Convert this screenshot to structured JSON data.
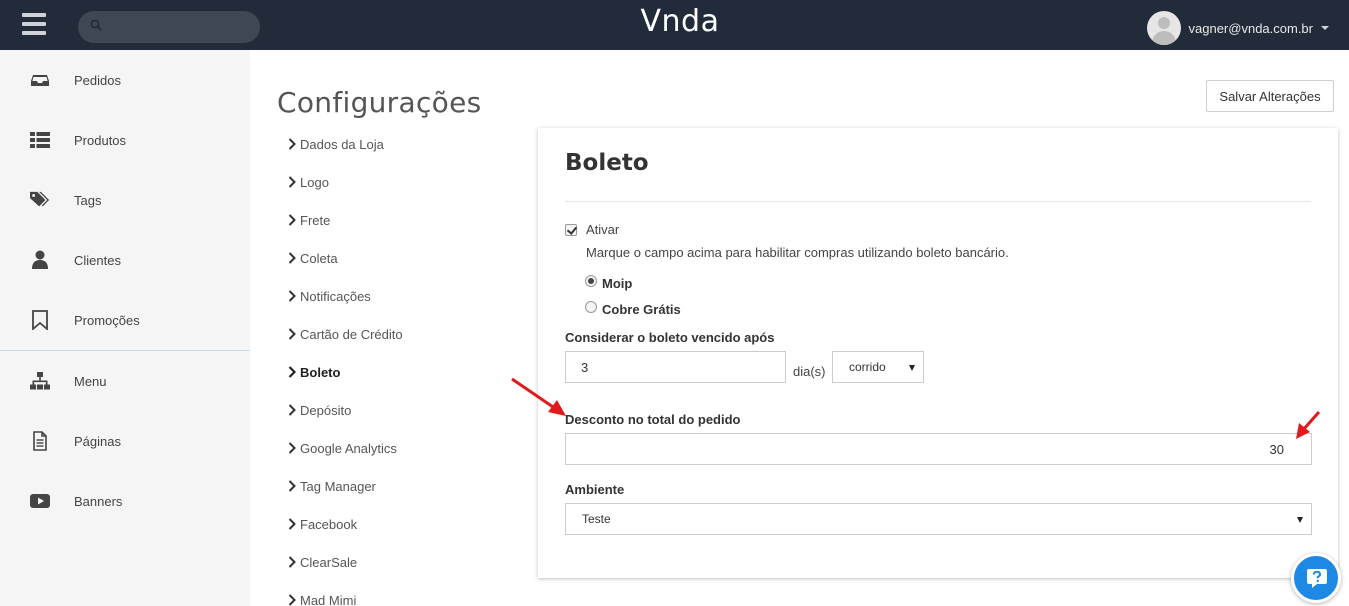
{
  "app": {
    "brand": "Vnda",
    "search_placeholder": "",
    "user_email": "vagner@vnda.com.br"
  },
  "sidebar": {
    "items": [
      {
        "label": "Pedidos",
        "icon": "inbox-icon"
      },
      {
        "label": "Produtos",
        "icon": "list-icon"
      },
      {
        "label": "Tags",
        "icon": "tags-icon"
      },
      {
        "label": "Clientes",
        "icon": "user-icon"
      },
      {
        "label": "Promoções",
        "icon": "bookmark-icon"
      },
      {
        "label": "Menu",
        "icon": "sitemap-icon"
      },
      {
        "label": "Páginas",
        "icon": "file-icon"
      },
      {
        "label": "Banners",
        "icon": "youtube-play-icon"
      }
    ]
  },
  "page": {
    "title": "Configurações",
    "save_label": "Salvar Alterações"
  },
  "config_menu": {
    "active": "Boleto",
    "items": [
      "Dados da Loja",
      "Logo",
      "Frete",
      "Coleta",
      "Notificações",
      "Cartão de Crédito",
      "Boleto",
      "Depósito",
      "Google Analytics",
      "Tag Manager",
      "Facebook",
      "ClearSale",
      "Mad Mimi"
    ]
  },
  "boleto": {
    "title": "Boleto",
    "activate_label": "Ativar",
    "activate_checked": true,
    "activate_help": "Marque o campo acima para habilitar compras utilizando boleto bancário.",
    "provider_options": [
      "Moip",
      "Cobre Grátis"
    ],
    "provider_selected": "Moip",
    "due_label": "Considerar o boleto vencido após",
    "due_value": "3",
    "due_unit": "dia(s)",
    "due_type": "corrido",
    "discount_label": "Desconto no total do pedido",
    "discount_value": "30",
    "env_label": "Ambiente",
    "env_value": "Teste"
  },
  "colors": {
    "topbar": "#222b3a",
    "sidebar": "#f5f5f5",
    "accent": "#1e88e5",
    "annotation": "#e01a1a"
  }
}
